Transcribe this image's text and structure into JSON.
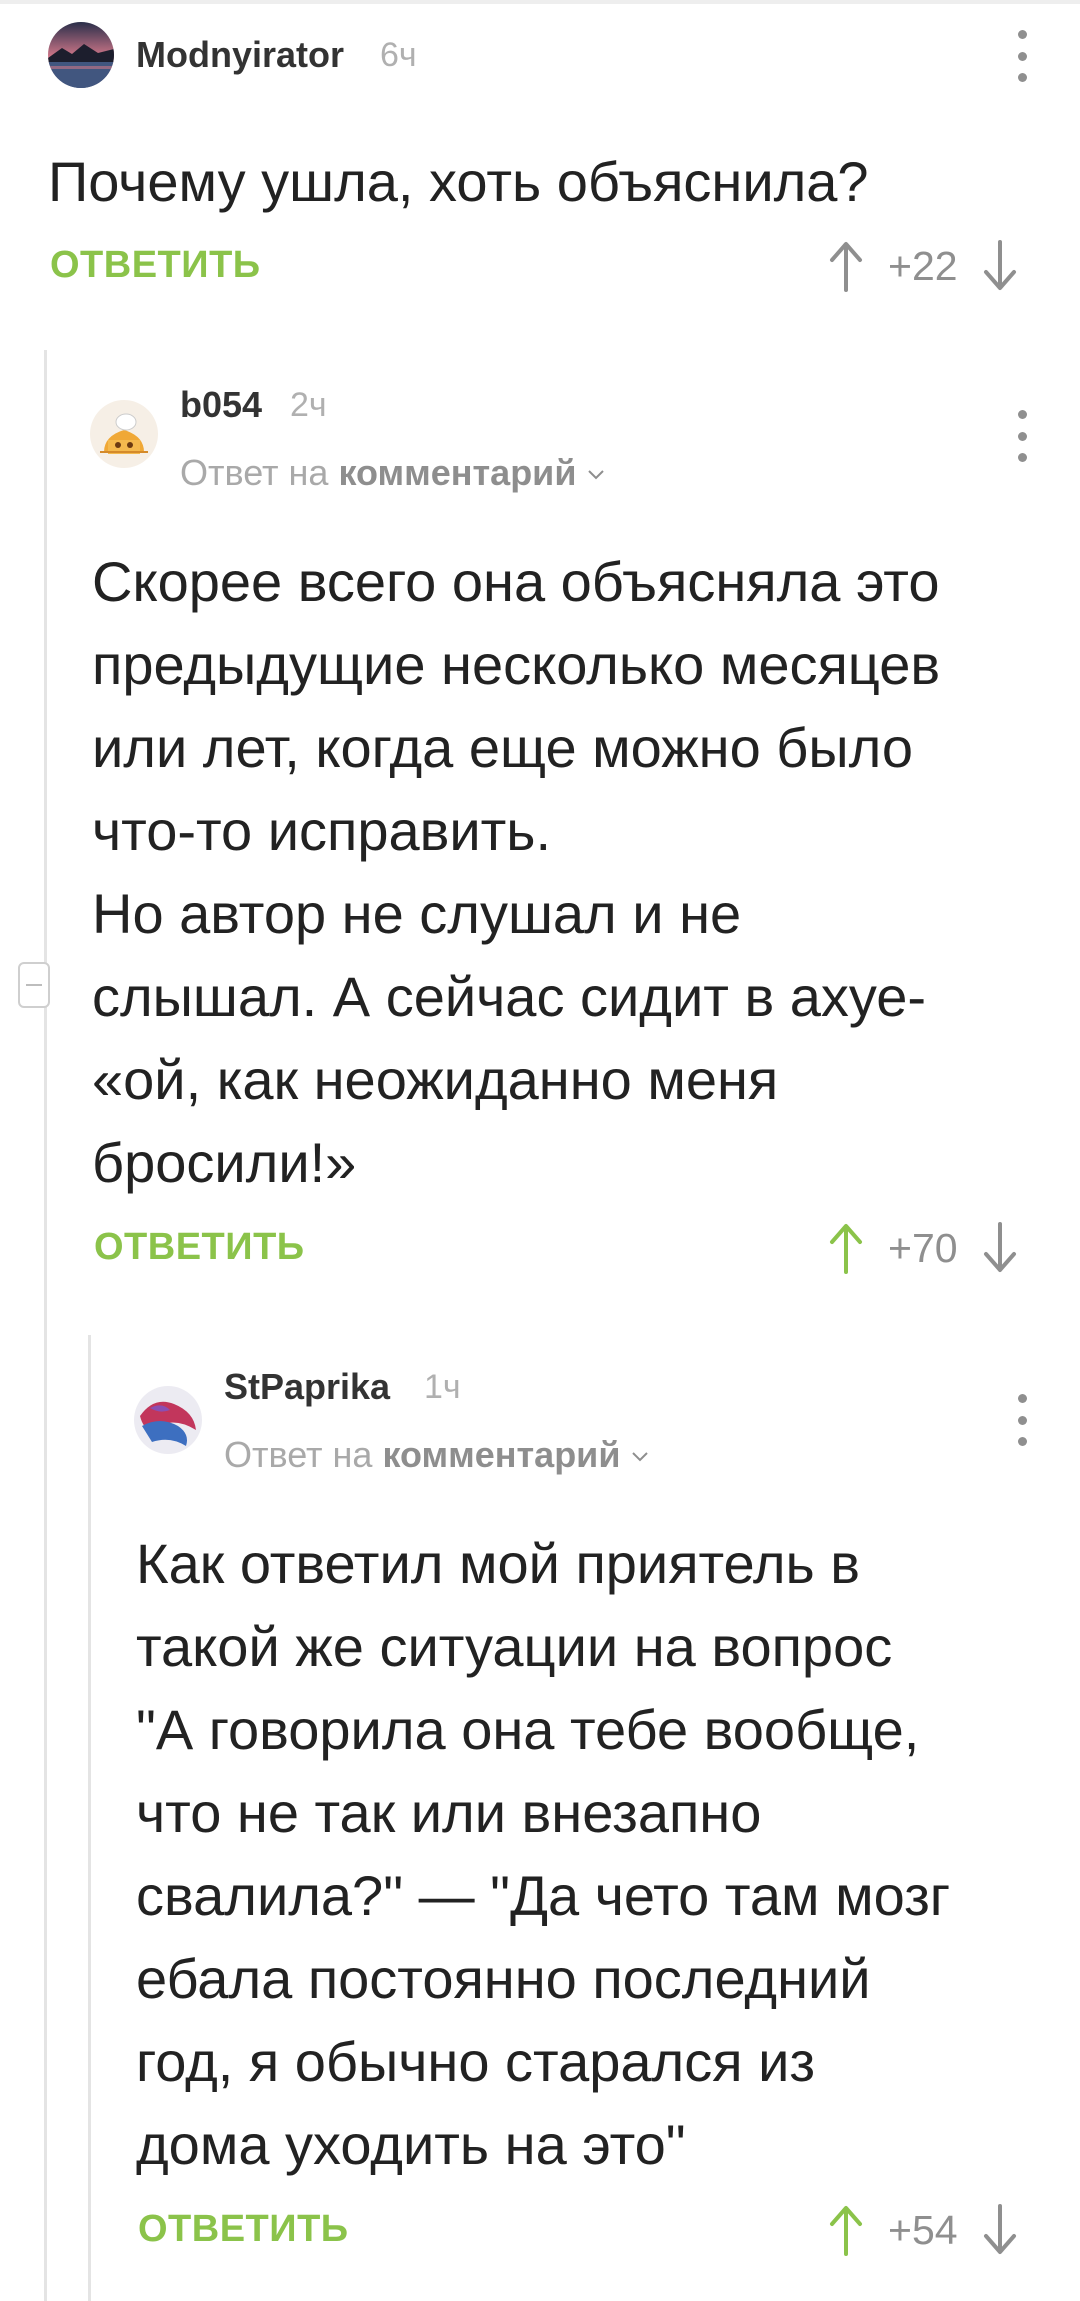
{
  "comments": [
    {
      "author": "Modnyirator",
      "time": "6ч",
      "body": "Почему ушла, хоть объяснила?",
      "reply_label": "ОТВЕТИТЬ",
      "score": "+22",
      "score_color": "#8f8f8f",
      "avatar_icon": "landscape-avatar-icon"
    },
    {
      "author": "b054",
      "time": "2ч",
      "reply_prefix": "Ответ на",
      "reply_target": "комментарий",
      "body": "Скорее всего она объясняла это\nпредыдущие несколько месяцев\nили лет, когда еще можно было\nчто-то исправить.\nНо автор не слушал и не\nслышал. А сейчас сидит в ахуе-\n«ой, как неожиданно меня\nбросили!»",
      "reply_label": "ОТВЕТИТЬ",
      "score": "+70",
      "upvoted": true,
      "accent": "#8bc34a",
      "avatar_icon": "cartoon-house-avatar-icon"
    },
    {
      "author": "StPaprika",
      "time": "1ч",
      "reply_prefix": "Ответ на",
      "reply_target": "комментарий",
      "body": "Как ответил мой приятель в\nтакой же ситуации на вопрос\n\"А говорила она тебе вообще,\nчто не так или внезапно\nсвалила?\" — \"Да чето там мозг\nебала постоянно последний\nгод, я обычно старался из\nдома уходить на это\"",
      "reply_label": "ОТВЕТИТЬ",
      "score": "+54",
      "upvoted": true,
      "accent": "#8bc34a",
      "avatar_icon": "abstract-avatar-icon"
    }
  ]
}
